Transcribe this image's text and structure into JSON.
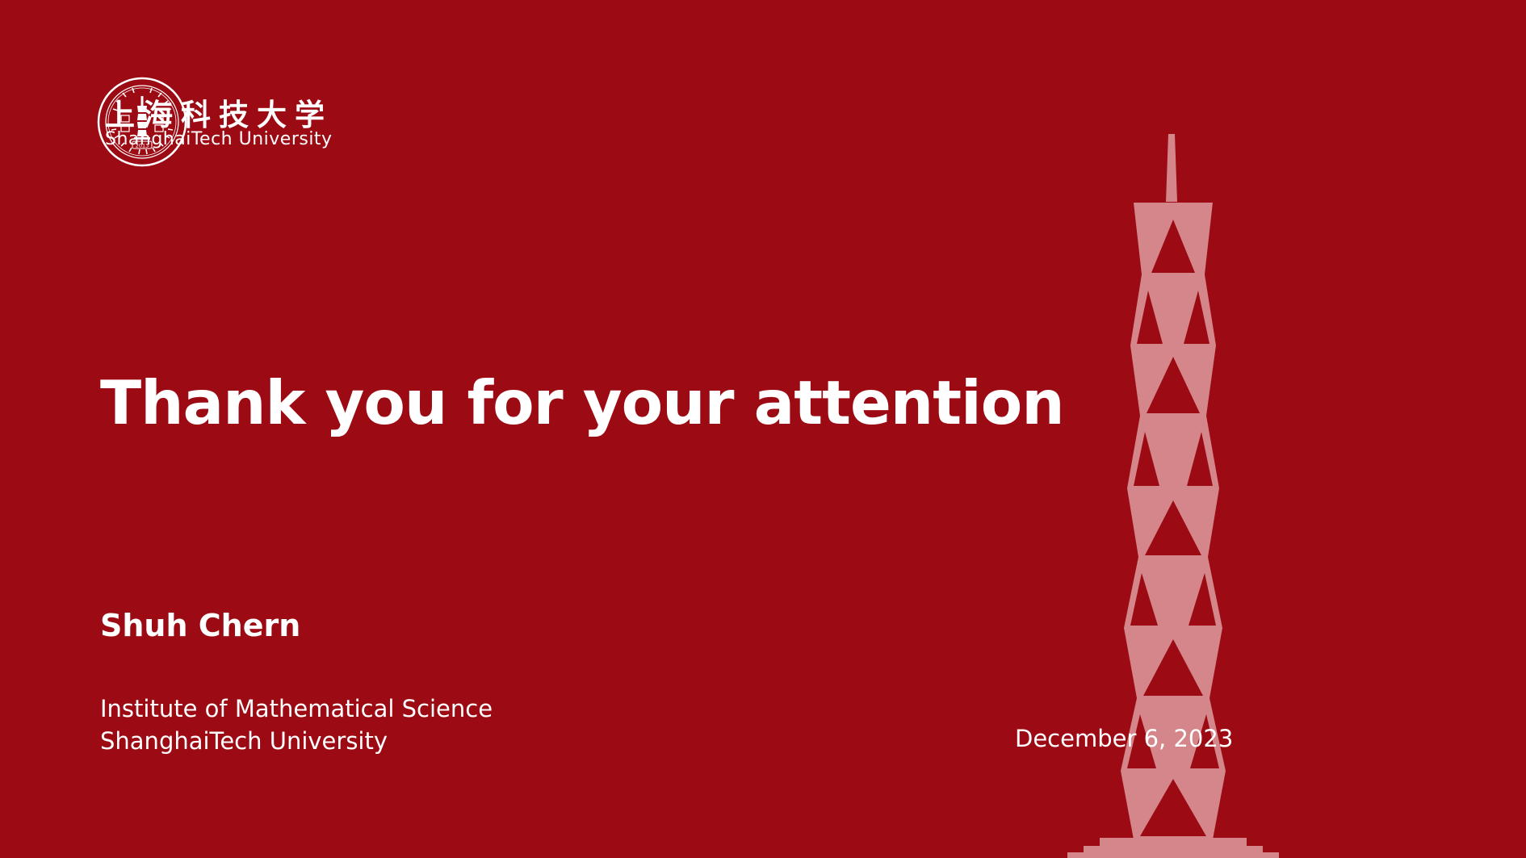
{
  "logo": {
    "name_cn": "上海科技大学",
    "name_en": "ShanghaiTech University",
    "seal_year": "2013"
  },
  "title": "Thank you for your attention",
  "author": "Shuh Chern",
  "affiliation": {
    "line1": "Institute of Mathematical Science",
    "line2": "ShanghaiTech University"
  },
  "date": "December 6, 2023",
  "colors": {
    "background": "#9c0a13",
    "text": "#ffffff",
    "tower": "#d4868b"
  }
}
